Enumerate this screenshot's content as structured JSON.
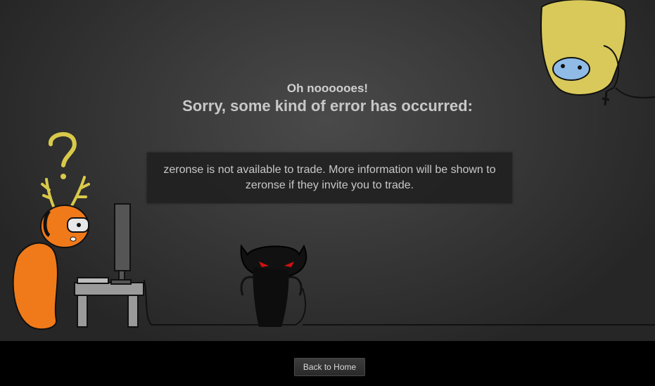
{
  "error": {
    "headline": "Oh noooooes!",
    "subheadline": "Sorry, some kind of error has occurred:",
    "message": "zeronse is not available to trade. More information will be shown to zeronse if they invite you to trade."
  },
  "footer": {
    "back_label": "Back to Home"
  },
  "icons": {
    "question": "question-mark-icon"
  },
  "colors": {
    "background": "#3a3a3a",
    "footer": "#000000",
    "text": "#c8c8c8",
    "orange_character": "#f07a1a",
    "yellow_character": "#d8c95a"
  }
}
